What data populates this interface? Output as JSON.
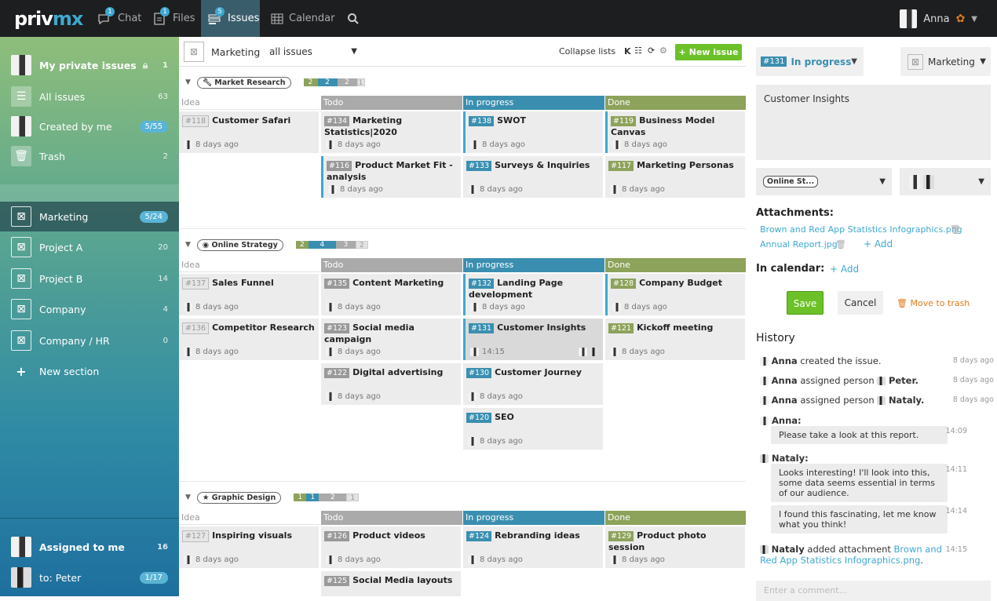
{
  "app": {
    "logo_a": "priv",
    "logo_b": "mx"
  },
  "nav": {
    "chat": {
      "label": "Chat",
      "badge": "1"
    },
    "files": {
      "label": "Files",
      "badge": "1"
    },
    "issues": {
      "label": "Issues",
      "badge": "5"
    },
    "calendar": {
      "label": "Calendar"
    }
  },
  "user": {
    "name": "Anna"
  },
  "sidebar": {
    "private": {
      "label": "My private issues",
      "count": "1"
    },
    "all": {
      "label": "All issues",
      "count": "63"
    },
    "created": {
      "label": "Created by me",
      "count": "5/55"
    },
    "trash": {
      "label": "Trash",
      "count": "2"
    },
    "sections": [
      {
        "label": "Marketing",
        "count": "5/24"
      },
      {
        "label": "Project A",
        "count": "20"
      },
      {
        "label": "Project B",
        "count": "14"
      },
      {
        "label": "Company",
        "count": "4"
      },
      {
        "label": "Company / HR",
        "count": "0"
      }
    ],
    "new_section": "New section",
    "assigned": {
      "label": "Assigned to me",
      "count": "16"
    },
    "to_peter": {
      "label": "to: Peter",
      "count": "1/17"
    }
  },
  "toolbar": {
    "section": "Marketing",
    "filter": "all issues",
    "collapse": "Collapse lists",
    "new_issue": "New issue"
  },
  "columns": {
    "idea": "Idea",
    "todo": "Todo",
    "progress": "In progress",
    "done": "Done"
  },
  "groups": [
    {
      "tag": "Market Research",
      "counts": [
        "2",
        "2",
        "2",
        "1"
      ],
      "idea": [
        {
          "num": "#118",
          "title": "Customer Safari",
          "time": "8 days ago"
        }
      ],
      "todo": [
        {
          "num": "#134",
          "title": "Marketing Statistics|2020",
          "time": "8 days ago"
        },
        {
          "num": "#116",
          "title": "Product Market Fit - analysis",
          "time": "8 days ago"
        }
      ],
      "progress": [
        {
          "num": "#138",
          "title": "SWOT",
          "time": "8 days ago"
        },
        {
          "num": "#133",
          "title": "Surveys & Inquiries",
          "time": "8 days ago"
        }
      ],
      "done": [
        {
          "num": "#119",
          "title": "Business Model Canvas",
          "time": "8 days ago"
        },
        {
          "num": "#117",
          "title": "Marketing Personas",
          "time": "8 days ago"
        }
      ]
    },
    {
      "tag": "Online Strategy",
      "counts": [
        "2",
        "4",
        "3",
        "2"
      ],
      "idea": [
        {
          "num": "#137",
          "title": "Sales Funnel",
          "time": "8 days ago"
        },
        {
          "num": "#136",
          "title": "Competitor Research",
          "time": "8 days ago"
        }
      ],
      "todo": [
        {
          "num": "#135",
          "title": "Content Marketing",
          "time": "8 days ago"
        },
        {
          "num": "#123",
          "title": "Social media campaign",
          "time": "8 days ago"
        },
        {
          "num": "#122",
          "title": "Digital advertising",
          "time": "8 days ago"
        }
      ],
      "progress": [
        {
          "num": "#132",
          "title": "Landing Page development",
          "time": "8 days ago"
        },
        {
          "num": "#131",
          "title": "Customer Insights",
          "time": "14:15"
        },
        {
          "num": "#130",
          "title": "Customer Journey",
          "time": "8 days ago"
        },
        {
          "num": "#120",
          "title": "SEO",
          "time": "8 days ago"
        }
      ],
      "done": [
        {
          "num": "#128",
          "title": "Company Budget",
          "time": "8 days ago"
        },
        {
          "num": "#121",
          "title": "Kickoff meeting",
          "time": "8 days ago"
        }
      ]
    },
    {
      "tag": "Graphic Design",
      "counts": [
        "1",
        "1",
        "2",
        "1"
      ],
      "idea": [
        {
          "num": "#127",
          "title": "Inspiring visuals",
          "time": "8 days ago"
        }
      ],
      "todo": [
        {
          "num": "#126",
          "title": "Product videos",
          "time": "8 days ago"
        },
        {
          "num": "#125",
          "title": "Social Media layouts",
          "time": ""
        }
      ],
      "progress": [
        {
          "num": "#124",
          "title": "Rebranding ideas",
          "time": "8 days ago"
        }
      ],
      "done": [
        {
          "num": "#129",
          "title": "Product photo session",
          "time": "8 days ago"
        }
      ]
    }
  ],
  "detail": {
    "status_num": "#131",
    "status": "In progress",
    "section": "Marketing",
    "title": "Customer Insights",
    "tag": "Online St...",
    "attachments_label": "Attachments:",
    "attachments": [
      "Brown and Red App Statistics Infographics.png",
      "Annual Report.jpg"
    ],
    "add": "Add",
    "calendar_label": "In calendar:",
    "save": "Save",
    "cancel": "Cancel",
    "trash": "Move to trash",
    "history_label": "History",
    "history": [
      {
        "who": "Anna",
        "text": "created the issue.",
        "time": "8 days ago"
      },
      {
        "who": "Anna",
        "text": "assigned person",
        "target": "Peter.",
        "time": "8 days ago"
      },
      {
        "who": "Anna",
        "text": "assigned person",
        "target": "Nataly.",
        "time": "8 days ago"
      }
    ],
    "comments": [
      {
        "who": "Anna:",
        "text": "Please take a look at this report.",
        "time": "14:09"
      },
      {
        "who": "Nataly:",
        "text": "Looks interesting! I'll look into this, some data seems essential in terms of our audience.",
        "time": "14:11"
      },
      {
        "who": "",
        "text": "I found this fascinating, let me know what you think!",
        "time": "14:14"
      }
    ],
    "attach_event": {
      "who": "Nataly",
      "text": "added attachment",
      "file": "Brown and Red App Statistics Infographics.png",
      "time": "14:15"
    },
    "comment_placeholder": "Enter a comment..."
  }
}
